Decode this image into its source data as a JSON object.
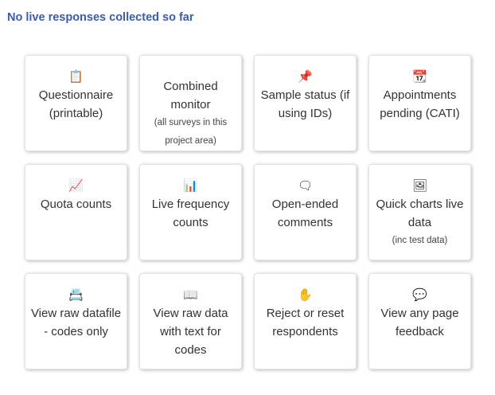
{
  "notice": "No live responses collected so far",
  "tiles": [
    {
      "icon": "clipboard-icon",
      "glyph": "📋",
      "label": "Questionnaire (printable)",
      "sub": ""
    },
    {
      "icon": "monitor-icon",
      "glyph": "",
      "label": "Combined monitor",
      "sub": "(all surveys in this project area)"
    },
    {
      "icon": "pushpin-icon",
      "glyph": "📌",
      "label": "Sample status (if using IDs)",
      "sub": ""
    },
    {
      "icon": "calendar-icon",
      "glyph": "📆",
      "label": "Appointments pending (CATI)",
      "sub": ""
    },
    {
      "icon": "line-chart-icon",
      "glyph": "📈",
      "label": "Quota counts",
      "sub": ""
    },
    {
      "icon": "bar-chart-icon",
      "glyph": "📊",
      "label": "Live frequency counts",
      "sub": ""
    },
    {
      "icon": "thought-bubble-icon",
      "glyph": "🗨",
      "label": "Open-ended comments",
      "sub": ""
    },
    {
      "icon": "picture-icon",
      "glyph": "🖼",
      "label": "Quick charts live data",
      "sub": "(inc test data)"
    },
    {
      "icon": "card-index-icon",
      "glyph": "📇",
      "label": "View raw datafile - codes only",
      "sub": ""
    },
    {
      "icon": "open-book-icon",
      "glyph": "📖",
      "label": "View raw data with text for codes",
      "sub": ""
    },
    {
      "icon": "raised-hand-icon",
      "glyph": "✋",
      "label": "Reject or reset respondents",
      "sub": ""
    },
    {
      "icon": "speech-bubble-icon",
      "glyph": "💬",
      "label": "View any page feedback",
      "sub": ""
    }
  ]
}
